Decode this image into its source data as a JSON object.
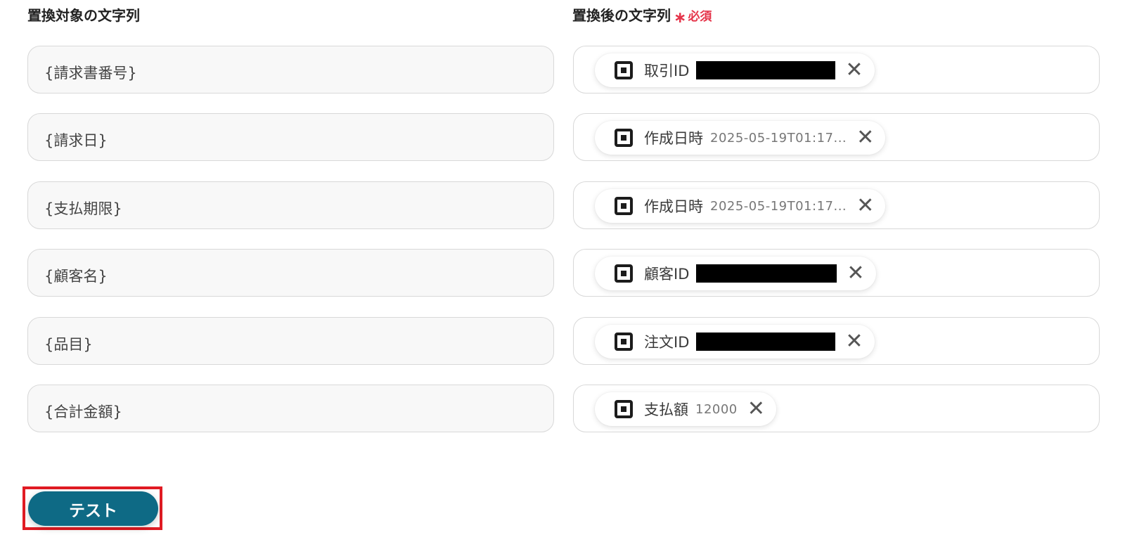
{
  "headings": {
    "source": "置換対象の文字列",
    "target": "置換後の文字列",
    "required_mark": "∗",
    "required_text": "必須"
  },
  "rows": [
    {
      "source": "{請求書番号}",
      "chip_label": "取引ID",
      "chip_value": "",
      "redacted": true
    },
    {
      "source": "{請求日}",
      "chip_label": "作成日時",
      "chip_value": "2025-05-19T01:17...",
      "redacted": false
    },
    {
      "source": "{支払期限}",
      "chip_label": "作成日時",
      "chip_value": "2025-05-19T01:17...",
      "redacted": false
    },
    {
      "source": "{顧客名}",
      "chip_label": "顧客ID",
      "chip_value": "",
      "redacted": true
    },
    {
      "source": "{品目}",
      "chip_label": "注文ID",
      "chip_value": "",
      "redacted": true
    },
    {
      "source": "{合計金額}",
      "chip_label": "支払額",
      "chip_value": "12000",
      "redacted": false
    }
  ],
  "chip_icon": "square-app-icon",
  "chip_close_glyph": "✕",
  "test_button": {
    "label": "テスト"
  },
  "colors": {
    "accent": "#0e6a85",
    "required": "#e5344a",
    "highlight": "#e11b23"
  }
}
